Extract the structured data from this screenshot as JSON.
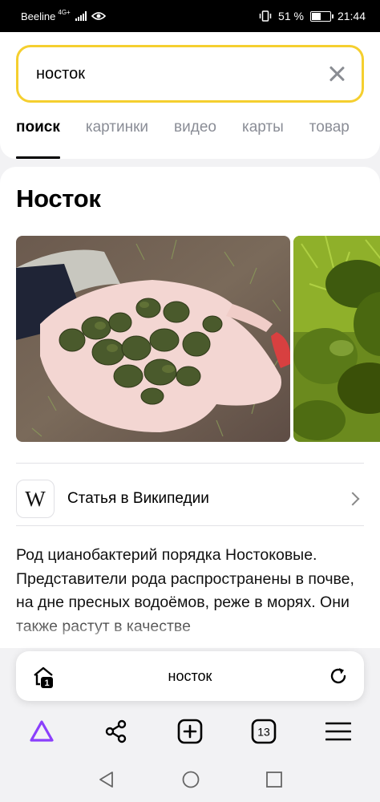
{
  "status_bar": {
    "carrier": "Beeline",
    "network": "4G+",
    "battery_percent": "51 %",
    "battery_level": 0.51,
    "time": "21:44"
  },
  "search": {
    "query": "носток"
  },
  "tabs": [
    {
      "label": "поиск",
      "active": true
    },
    {
      "label": "картинки",
      "active": false
    },
    {
      "label": "видео",
      "active": false
    },
    {
      "label": "карты",
      "active": false
    },
    {
      "label": "товар",
      "active": false
    }
  ],
  "entity": {
    "title": "Носток",
    "wiki_logo": "W",
    "wiki_label": "Статья в Википедии",
    "description": "Род цианобактерий порядка Ностоковые. Представители рода распространены в почве, на дне пресных водоёмов, реже в морях. Они также растут в качестве"
  },
  "address_bar": {
    "text": "носток",
    "home_badge": "1"
  },
  "toolbar": {
    "tab_count": "13",
    "items": [
      "alice-icon",
      "share-icon",
      "new-tab-icon",
      "tabs-icon",
      "menu-icon"
    ]
  },
  "colors": {
    "search_border": "#f5cf2f",
    "alice_accent": "#8b3ffc",
    "tab_inactive": "#8a8d96"
  }
}
